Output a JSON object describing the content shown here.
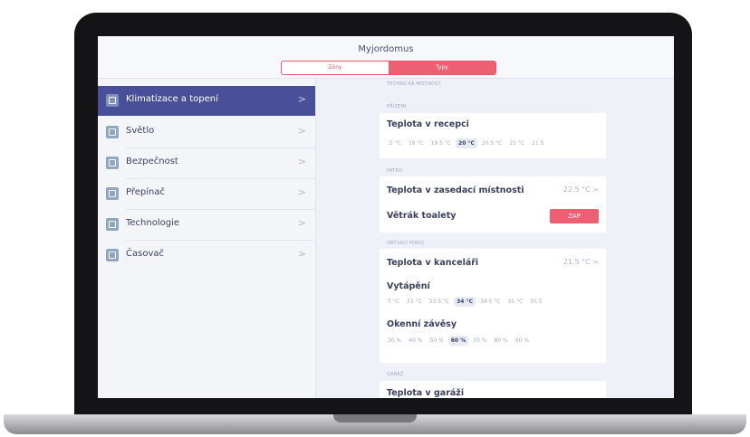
{
  "app": {
    "title": "Myjordomus"
  },
  "segmented": {
    "zones_label": "Zóny",
    "types_label": "Typy"
  },
  "sidebar": {
    "items": [
      {
        "label": "Klimatizace a topení",
        "icon": "thermostat-icon",
        "active": true
      },
      {
        "label": "Světlo",
        "icon": "light-icon"
      },
      {
        "label": "Bezpečnost",
        "icon": "security-icon"
      },
      {
        "label": "Přepínač",
        "icon": "switch-icon"
      },
      {
        "label": "Technologie",
        "icon": "technology-icon"
      },
      {
        "label": "Časovač",
        "icon": "timer-icon"
      }
    ],
    "chevron": ">"
  },
  "content": {
    "top_section": "TECHNICKÁ MÍSTNOST",
    "prizemi": {
      "title": "PŘÍZEMÍ",
      "row_title": "Teplota v recepci",
      "chips": [
        ".5 °C",
        "19 °C",
        "19.5 °C",
        "20 °C",
        "20.5 °C",
        "21 °C",
        "21.5"
      ],
      "selected": "20 °C"
    },
    "patro": {
      "title": "PATRO",
      "row1_title": "Teplota v zasedací místnosti",
      "row1_value": "22.5 °C",
      "row2_title": "Větrák toalety",
      "row2_button": "ZAP"
    },
    "obyvaci": {
      "title": "OBÝVACÍ POKOJ",
      "row1_title": "Teplota v kanceláři",
      "row1_value": "21.5 °C",
      "heating_title": "Vytápění",
      "heating_chips": [
        "5 °C",
        "33 °C",
        "33.5 °C",
        "34 °C",
        "34.5 °C",
        "35 °C",
        "35.5"
      ],
      "heating_selected": "34 °C",
      "blinds_title": "Okenní závěsy",
      "blinds_chips": [
        "30 %",
        "40 %",
        "50 %",
        "60 %",
        "70 %",
        "80 %",
        "90 %"
      ],
      "blinds_selected": "60 %"
    },
    "garaz": {
      "title": "GARÁŽ",
      "row_title": "Teplota v garáži"
    }
  },
  "colors": {
    "accent": "#ee5f74",
    "sidebar_active": "#4a4f9a",
    "text": "#3b3f60"
  }
}
